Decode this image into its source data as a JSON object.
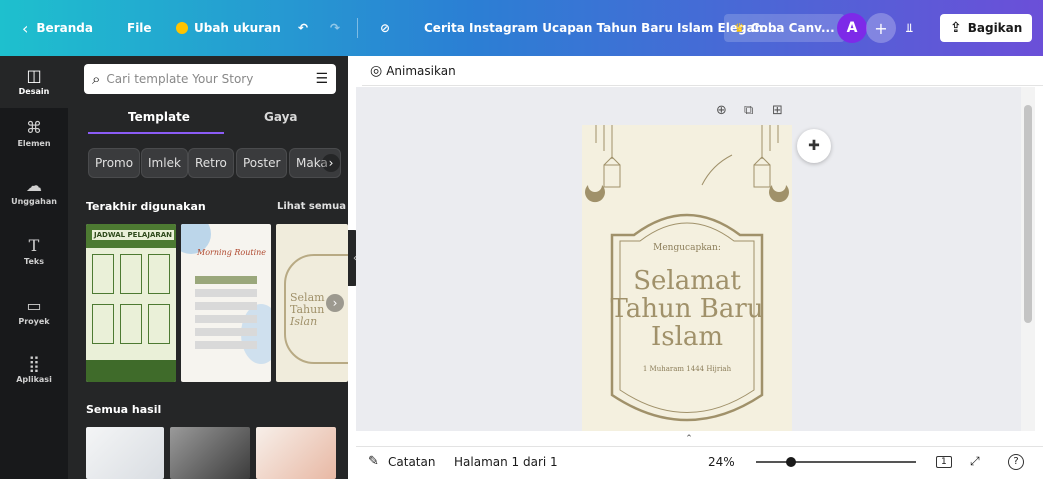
{
  "topbar": {
    "back_label": "Beranda",
    "file_label": "File",
    "resize_label": "Ubah ukuran",
    "doc_title": "Cerita Instagram Ucapan Tahun Baru Islam Elegan...",
    "try_label": "Coba Canv...",
    "avatar_initial": "A",
    "share_label": "Bagikan"
  },
  "rail": {
    "items": [
      {
        "label": "Desain",
        "icon": "layout-icon"
      },
      {
        "label": "Elemen",
        "icon": "shapes-icon"
      },
      {
        "label": "Unggahan",
        "icon": "cloud-upload-icon"
      },
      {
        "label": "Teks",
        "icon": "text-icon"
      },
      {
        "label": "Proyek",
        "icon": "folder-icon"
      },
      {
        "label": "Aplikasi",
        "icon": "apps-grid-icon"
      }
    ]
  },
  "panel": {
    "search_placeholder": "Cari template Your Story",
    "tabs": [
      "Template",
      "Gaya"
    ],
    "chips": [
      "Promo",
      "Imlek",
      "Retro",
      "Poster",
      "Maka"
    ],
    "recent_title": "Terakhir digunakan",
    "see_all": "Lihat semua",
    "all_results": "Semua hasil",
    "thumb1": {
      "title": "JADWAL PELAJARAN"
    },
    "thumb2": {
      "title": "Morning Routine"
    },
    "thumb3": {
      "line1": "Selam",
      "line2": "Tahun",
      "line3": "Islan"
    }
  },
  "editor": {
    "animate_label": "Animasikan",
    "design": {
      "greeting": "Mengucapkan:",
      "title_line1": "Selamat",
      "title_line2": "Tahun Baru",
      "title_line3": "Islam",
      "date": "1 Muharam 1444 Hijriah"
    }
  },
  "bottombar": {
    "notes_label": "Catatan",
    "page_label": "Halaman 1 dari 1",
    "zoom": "24%",
    "zoom_fraction": 0.22,
    "page_count": "1"
  },
  "colors": {
    "accent": "#8b5cf6",
    "rail_bg": "#18191b",
    "panel_bg": "#252627",
    "design_bg": "#f4f0df",
    "design_ink": "#a0916a"
  }
}
